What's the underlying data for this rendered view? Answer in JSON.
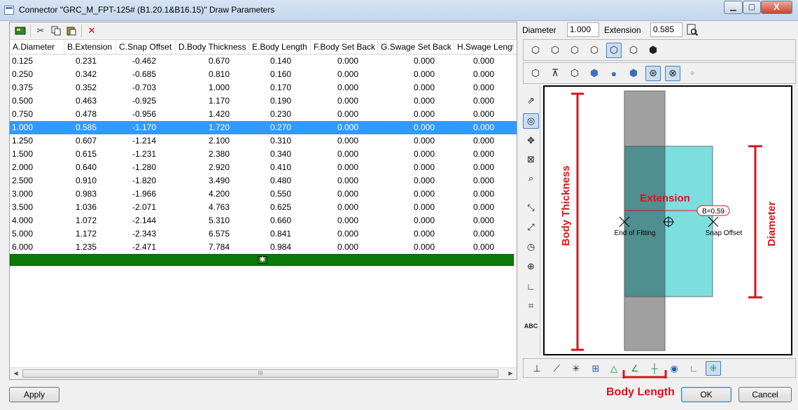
{
  "window": {
    "title": "Connector \"GRC_M_FPT-125# (B1.20.1&B16.15)\" Draw Parameters",
    "min_icon": "minimize-icon",
    "max_icon": "maximize-icon",
    "close_label": "X"
  },
  "toolbar": {
    "icons": [
      "table-icon",
      "cut-icon",
      "copy-icon",
      "paste-icon",
      "delete-icon"
    ]
  },
  "table": {
    "columns": [
      "A.Diameter",
      "B.Extension",
      "C.Snap Offset",
      "D.Body Thickness",
      "E.Body Length",
      "F.Body Set Back",
      "G.Swage Set Back",
      "H.Swage Length"
    ],
    "selected_row": 5,
    "rows": [
      [
        "0.125",
        "0.231",
        "-0.462",
        "0.670",
        "0.140",
        "0.000",
        "0.000",
        "0.000"
      ],
      [
        "0.250",
        "0.342",
        "-0.685",
        "0.810",
        "0.160",
        "0.000",
        "0.000",
        "0.000"
      ],
      [
        "0.375",
        "0.352",
        "-0.703",
        "1.000",
        "0.170",
        "0.000",
        "0.000",
        "0.000"
      ],
      [
        "0.500",
        "0.463",
        "-0.925",
        "1.170",
        "0.190",
        "0.000",
        "0.000",
        "0.000"
      ],
      [
        "0.750",
        "0.478",
        "-0.956",
        "1.420",
        "0.230",
        "0.000",
        "0.000",
        "0.000"
      ],
      [
        "1.000",
        "0.585",
        "-1.170",
        "1.720",
        "0.270",
        "0.000",
        "0.000",
        "0.000"
      ],
      [
        "1.250",
        "0.607",
        "-1.214",
        "2.100",
        "0.310",
        "0.000",
        "0.000",
        "0.000"
      ],
      [
        "1.500",
        "0.615",
        "-1.231",
        "2.380",
        "0.340",
        "0.000",
        "0.000",
        "0.000"
      ],
      [
        "2.000",
        "0.640",
        "-1.280",
        "2.920",
        "0.410",
        "0.000",
        "0.000",
        "0.000"
      ],
      [
        "2.500",
        "0.910",
        "-1.820",
        "3.490",
        "0.480",
        "0.000",
        "0.000",
        "0.000"
      ],
      [
        "3.000",
        "0.983",
        "-1.966",
        "4.200",
        "0.550",
        "0.000",
        "0.000",
        "0.000"
      ],
      [
        "3.500",
        "1.036",
        "-2.071",
        "4.763",
        "0.625",
        "0.000",
        "0.000",
        "0.000"
      ],
      [
        "4.000",
        "1.072",
        "-2.144",
        "5.310",
        "0.660",
        "0.000",
        "0.000",
        "0.000"
      ],
      [
        "5.000",
        "1.172",
        "-2.343",
        "6.575",
        "0.841",
        "0.000",
        "0.000",
        "0.000"
      ],
      [
        "6.000",
        "1.235",
        "-2.471",
        "7.784",
        "0.984",
        "0.000",
        "0.000",
        "0.000"
      ]
    ],
    "new_row_icon": "new-row-star-icon",
    "scroll_thumb_grip": "III"
  },
  "params": {
    "diameter_label": "Diameter",
    "diameter_value": "1.000",
    "extension_label": "Extension",
    "extension_value": "0.585",
    "preview_icon": "zoom-page-icon"
  },
  "drawing": {
    "body_thickness_label": "Body Thickness",
    "extension_label": "Extension",
    "diameter_label": "Diameter",
    "end_of_fitting_label": "End of Fitting",
    "snap_offset_label": "Snap Offset",
    "dimension_value": "B=0.59",
    "body_length_label": "Body Length",
    "red_color": "#d9141c",
    "body_color": "#a0a0a0",
    "body_overlap_color": "#4f8f8f",
    "swage_color": "#7ddede"
  },
  "buttons": {
    "apply": "Apply",
    "ok": "OK",
    "cancel": "Cancel"
  }
}
